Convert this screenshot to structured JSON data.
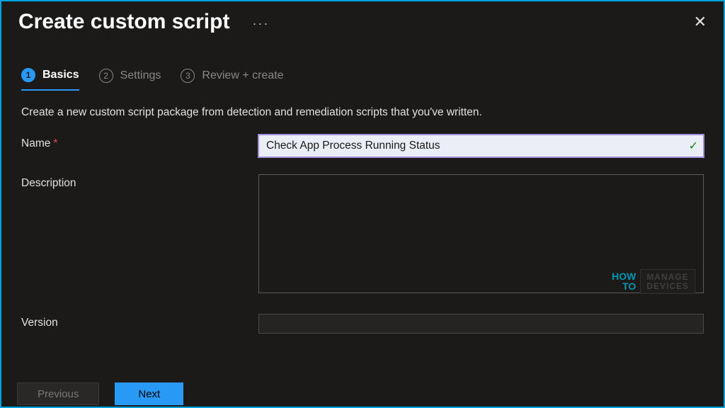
{
  "header": {
    "title": "Create custom script",
    "ellipsis": "···"
  },
  "tabs": [
    {
      "num": "1",
      "label": "Basics",
      "active": true
    },
    {
      "num": "2",
      "label": "Settings",
      "active": false
    },
    {
      "num": "3",
      "label": "Review + create",
      "active": false
    }
  ],
  "subtitle": "Create a new custom script package from detection and remediation scripts that you've written.",
  "form": {
    "name_label": "Name",
    "name_required": "*",
    "name_value": "Check App Process Running Status",
    "desc_label": "Description",
    "desc_value": "",
    "version_label": "Version",
    "version_value": ""
  },
  "footer": {
    "previous": "Previous",
    "next": "Next"
  },
  "watermark": {
    "how": "HOW",
    "to": "TO",
    "manage": "MANAGE",
    "devices": "DEVICES"
  }
}
